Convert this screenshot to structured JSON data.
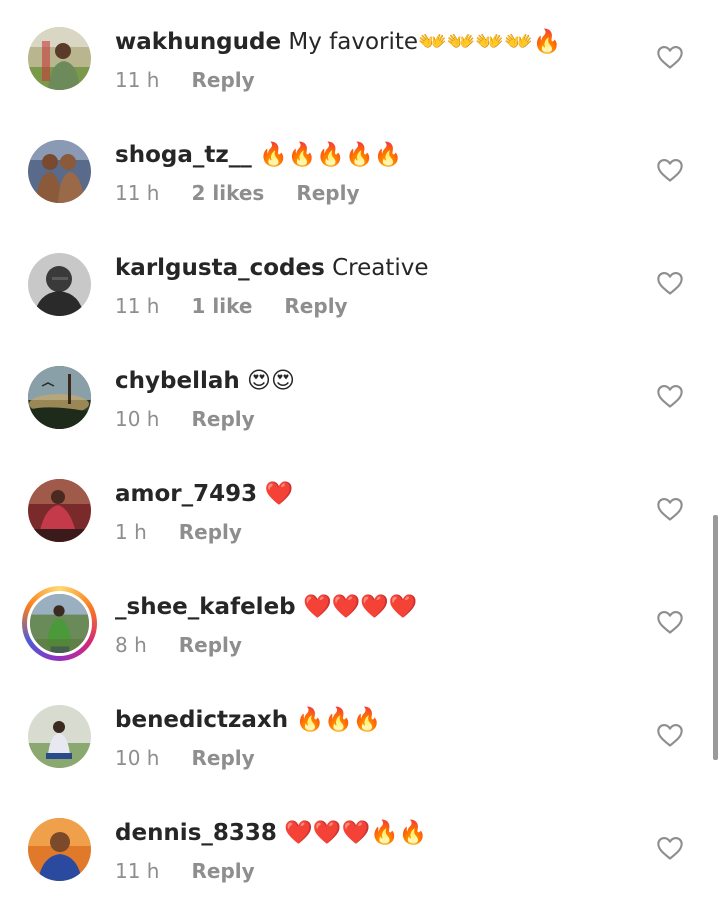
{
  "comments": [
    {
      "username": "wakhungude",
      "text": " My favorite👐👐👐👐🔥",
      "time": "11 h",
      "likes": "",
      "reply_label": "Reply"
    },
    {
      "username": "shoga_tz__",
      "text": " 🔥🔥🔥🔥🔥",
      "time": "11 h",
      "likes": "2 likes",
      "reply_label": "Reply"
    },
    {
      "username": "karlgusta_codes",
      "text": " Creative",
      "time": "11 h",
      "likes": "1 like",
      "reply_label": "Reply"
    },
    {
      "username": "chybellah",
      "text": " 😍😍",
      "time": "10 h",
      "likes": "",
      "reply_label": "Reply"
    },
    {
      "username": "amor_7493",
      "text": " ❤️",
      "time": "1 h",
      "likes": "",
      "reply_label": "Reply"
    },
    {
      "username": "_shee_kafeleb",
      "text": " ❤️❤️❤️❤️",
      "time": "8 h",
      "likes": "",
      "reply_label": "Reply"
    },
    {
      "username": "benedictzaxh",
      "text": " 🔥🔥🔥",
      "time": "10 h",
      "likes": "",
      "reply_label": "Reply"
    },
    {
      "username": "dennis_8338",
      "text": " ❤️❤️❤️🔥🔥",
      "time": "11 h",
      "likes": "",
      "reply_label": "Reply"
    }
  ],
  "icons": {
    "like": "heart-outline-icon"
  },
  "colors": {
    "text_primary": "#262626",
    "text_secondary": "#8e8e8e",
    "story_ring": "#d62976"
  }
}
